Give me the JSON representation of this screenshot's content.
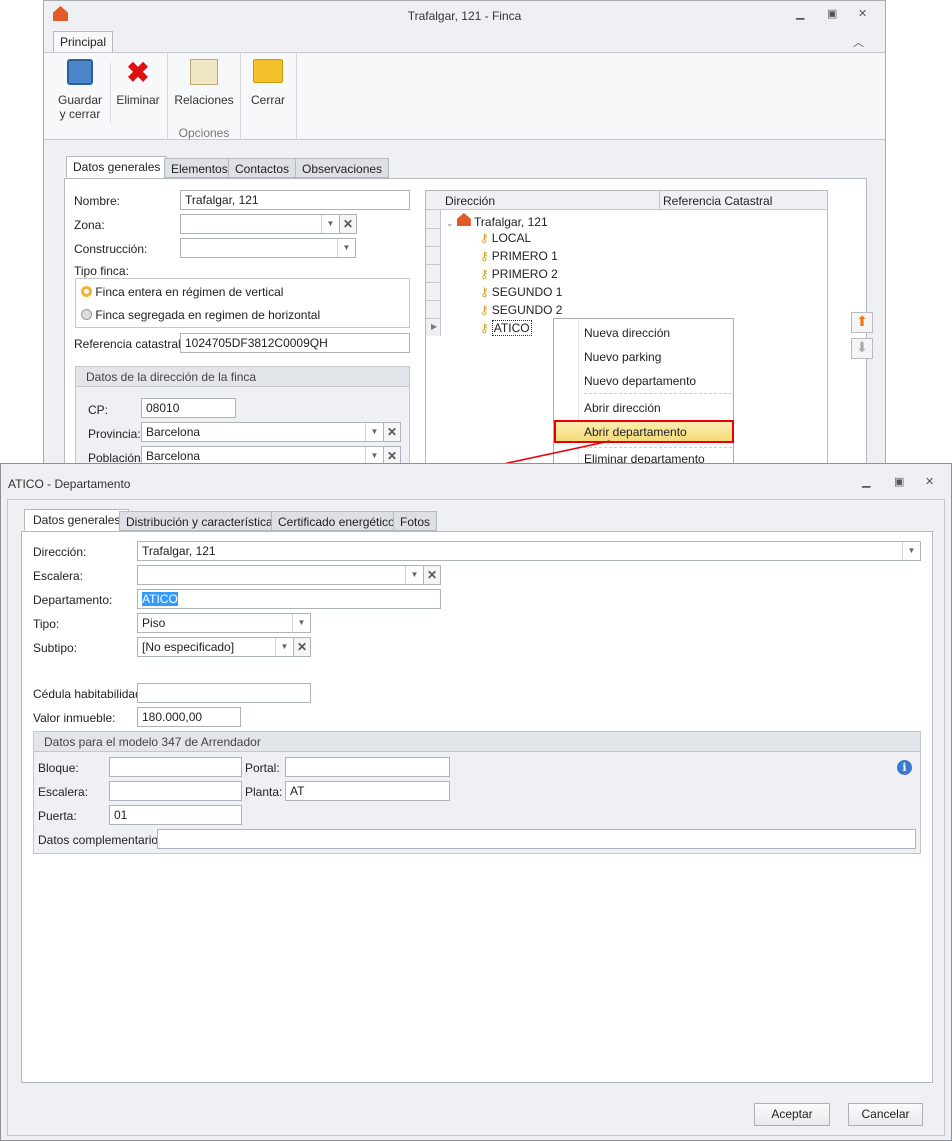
{
  "finca_window": {
    "title": "Trafalgar, 121 - Finca",
    "ribbon_tab": "Principal",
    "ribbon": {
      "save": "Guardar y cerrar",
      "save_l1": "Guardar",
      "save_l2": "y cerrar",
      "delete": "Eliminar",
      "relations": "Relaciones",
      "close": "Cerrar",
      "group_label": "Opciones"
    },
    "tabs": [
      "Datos generales",
      "Elementos",
      "Contactos",
      "Observaciones"
    ],
    "form": {
      "nombre_label": "Nombre:",
      "nombre": "Trafalgar, 121",
      "zona_label": "Zona:",
      "zona": "",
      "construccion_label": "Construcción:",
      "construccion": "",
      "tipo_label": "Tipo finca:",
      "tipo_options": [
        "Finca entera en régimen de vertical",
        "Finca segregada en regimen de horizontal"
      ],
      "tipo_selected": 0,
      "ref_label": "Referencia catastral:",
      "ref": "1024705DF3812C0009QH"
    },
    "address_group": {
      "title": "Datos de la dirección de la finca",
      "cp_label": "CP:",
      "cp": "08010",
      "provincia_label": "Provincia:",
      "provincia": "Barcelona",
      "poblacion_label": "Población:",
      "poblacion": "Barcelona"
    },
    "tree": {
      "columns": [
        "Dirección",
        "Referencia Catastral"
      ],
      "root": "Trafalgar, 121",
      "items": [
        "LOCAL",
        "PRIMERO 1",
        "PRIMERO 2",
        "SEGUNDO 1",
        "SEGUNDO 2",
        "ATICO"
      ],
      "selected": "ATICO"
    },
    "context_menu": [
      "Nueva dirección",
      "Nuevo parking",
      "Nuevo departamento",
      "Abrir dirección",
      "Abrir departamento",
      "Eliminar departamento"
    ],
    "context_menu_highlighted": "Abrir departamento"
  },
  "dept_window": {
    "title": "ATICO - Departamento",
    "tabs": [
      "Datos generales",
      "Distribución y características",
      "Certificado energético",
      "Fotos"
    ],
    "form": {
      "direccion_label": "Dirección:",
      "direccion": "Trafalgar, 121",
      "escalera_label": "Escalera:",
      "escalera": "",
      "departamento_label": "Departamento:",
      "departamento": "ATICO",
      "tipo_label": "Tipo:",
      "tipo": "Piso",
      "subtipo_label": "Subtipo:",
      "subtipo": "[No especificado]",
      "cedula_label": "Cédula habitabilidad:",
      "cedula": "",
      "valor_label": "Valor inmueble:",
      "valor": "180.000,00"
    },
    "modelo347": {
      "title": "Datos para el modelo 347 de Arrendador",
      "bloque_label": "Bloque:",
      "bloque": "",
      "portal_label": "Portal:",
      "portal": "",
      "escalera_label": "Escalera:",
      "escalera": "",
      "planta_label": "Planta:",
      "planta": "AT",
      "puerta_label": "Puerta:",
      "puerta": "01",
      "complementarios_label": "Datos complementarios:",
      "complementarios": ""
    },
    "buttons": {
      "accept": "Aceptar",
      "cancel": "Cancelar"
    }
  },
  "colors": {
    "highlight": "#f7e08a",
    "annotation": "#e8000a",
    "selection": "#3399ff"
  }
}
